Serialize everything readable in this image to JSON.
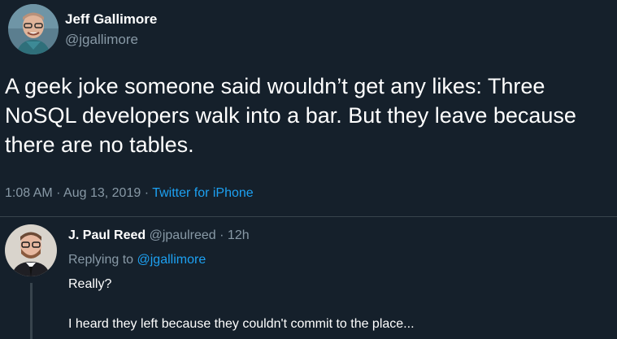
{
  "tweet": {
    "author_name": "Jeff Gallimore",
    "author_handle": "@jgallimore",
    "text": "A geek joke someone said wouldn’t get any likes: Three NoSQL developers walk into a bar. But they leave because there are no tables.",
    "time": "1:08 AM",
    "sep1": "·",
    "date": "Aug 13, 2019",
    "sep2": "·",
    "source": "Twitter for iPhone"
  },
  "reply": {
    "author_name": "J. Paul Reed",
    "author_handle": "@jpaulreed",
    "sep": "·",
    "time": "12h",
    "replying_prefix": "Replying to",
    "replying_to": "@jgallimore",
    "text_line1": "Really?",
    "text_line2": "I heard they left because they couldn't commit to the place..."
  },
  "colors": {
    "background": "#15202b",
    "text": "#ffffff",
    "secondary_text": "#8899a6",
    "link": "#1da1f2",
    "border": "#38444d"
  }
}
